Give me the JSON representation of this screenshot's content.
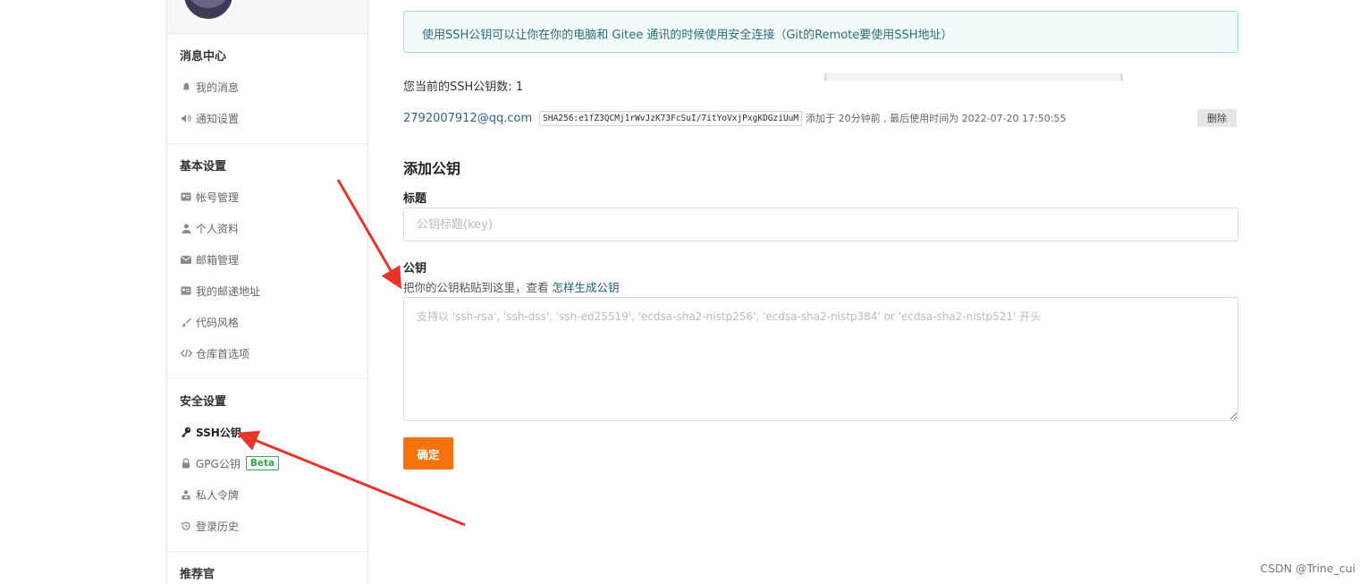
{
  "notice": "使用SSH公钥可以让你在你的电脑和 Gitee 通讯的时候使用安全连接（Git的Remote要使用SSH地址）",
  "sidebar": {
    "sections": [
      {
        "title": "消息中心",
        "items": [
          {
            "label": "我的消息",
            "icon": "bell-icon"
          },
          {
            "label": "通知设置",
            "icon": "speaker-icon"
          }
        ]
      },
      {
        "title": "基本设置",
        "items": [
          {
            "label": "帐号管理",
            "icon": "id-card-icon"
          },
          {
            "label": "个人资料",
            "icon": "user-icon"
          },
          {
            "label": "邮箱管理",
            "icon": "envelope-icon"
          },
          {
            "label": "我的邮递地址",
            "icon": "address-card-icon"
          },
          {
            "label": "代码风格",
            "icon": "brush-icon"
          },
          {
            "label": "仓库首选项",
            "icon": "code-icon"
          }
        ]
      },
      {
        "title": "安全设置",
        "items": [
          {
            "label": "SSH公钥",
            "icon": "key-icon",
            "active": true
          },
          {
            "label": "GPG公钥",
            "icon": "lock-icon",
            "badge": "Beta"
          },
          {
            "label": "私人令牌",
            "icon": "token-icon"
          },
          {
            "label": "登录历史",
            "icon": "history-icon"
          }
        ]
      },
      {
        "title": "推荐官"
      }
    ]
  },
  "ssh": {
    "count_text": "您当前的SSH公钥数: 1",
    "key": {
      "email": "2792007912@qq.com",
      "fingerprint": "SHA256:e1fZ3QCMj1rWvJzK73FcSuI/7itYoVxjPxgKDGziUuM",
      "meta": "添加于 20分钟前 , 最后使用时间为 2022-07-20 17:50:55",
      "delete_label": "删除"
    }
  },
  "form": {
    "heading": "添加公钥",
    "title_label": "标题",
    "title_placeholder": "公钥标题(key)",
    "key_label": "公钥",
    "hint_text": "把你的公钥粘贴到这里，查看",
    "hint_link": "怎样生成公钥",
    "key_placeholder": "支持以 'ssh-rsa', 'ssh-dss', 'ssh-ed25519', 'ecdsa-sha2-nistp256', 'ecdsa-sha2-nistp384' or 'ecdsa-sha2-nistp521' 开头",
    "submit_label": "确定"
  },
  "watermark": "CSDN @Trine_cui",
  "colors": {
    "accent": "#f5730c",
    "annotation_arrow": "#e8352b",
    "notice_bg": "#f1fbfb",
    "badge_green": "#2fa84f"
  }
}
